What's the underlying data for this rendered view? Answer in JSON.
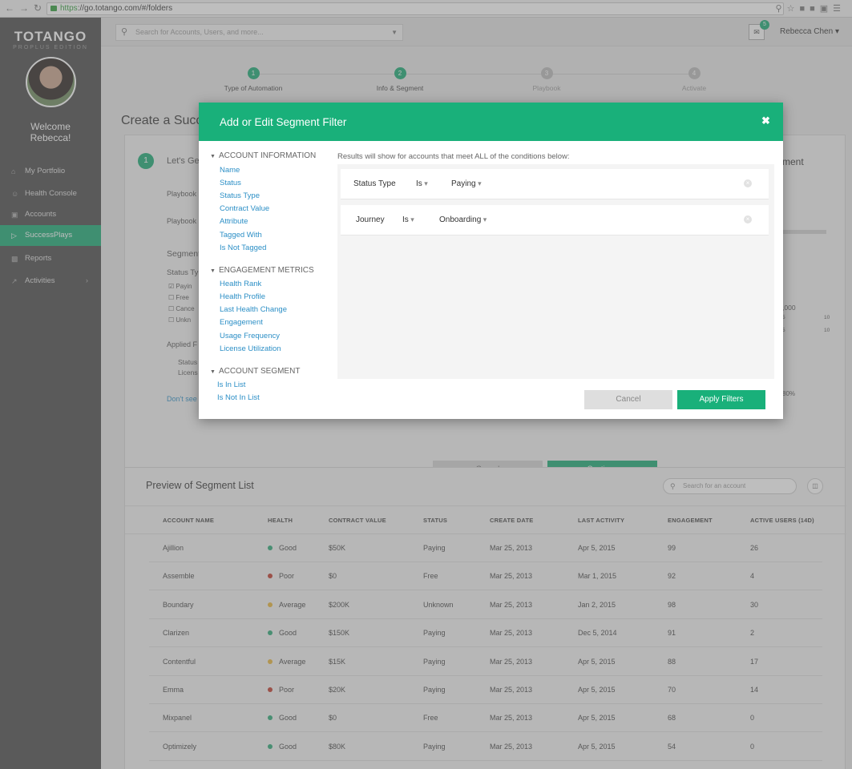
{
  "browser": {
    "url_https": "https",
    "url_rest": "://go.totango.com/#/folders"
  },
  "sidebar": {
    "logo": "TOTANGO",
    "edition": "PROPLUS EDITION",
    "welcome_line1": "Welcome",
    "welcome_line2": "Rebecca!",
    "items": [
      {
        "label": "My Portfolio",
        "icon": "home-icon"
      },
      {
        "label": "Health Console",
        "icon": "smiley-icon"
      },
      {
        "label": "Accounts",
        "icon": "briefcase-icon"
      },
      {
        "label": "SuccessPlays",
        "icon": "play-icon"
      },
      {
        "label": "Reports",
        "icon": "bar-chart-icon"
      },
      {
        "label": "Activities",
        "icon": "line-chart-icon"
      }
    ]
  },
  "header": {
    "search_placeholder": "Search for Accounts, Users, and more...",
    "inbox_count": "5",
    "user_name": "Rebecca Chen"
  },
  "steps": [
    {
      "num": "1",
      "label": "Type of Automation",
      "state": "done"
    },
    {
      "num": "2",
      "label": "Info & Segment",
      "state": "active"
    },
    {
      "num": "3",
      "label": "Playbook",
      "state": "todo"
    },
    {
      "num": "4",
      "label": "Activate",
      "state": "todo"
    }
  ],
  "page": {
    "title": "Create a Succ",
    "panel_step": "1",
    "lets_get": "Let's Ge",
    "playbook1": "Playbook",
    "playbook2": "Playbook",
    "segment": "Segment",
    "status_type": "Status Ty",
    "cb_paying": "Payin",
    "cb_free": "Free",
    "cb_cancel": "Cance",
    "cb_unknown": "Unkn",
    "applied": "Applied F",
    "applied_status": "Status",
    "applied_license": "Licens",
    "dont_see": "Don't see",
    "right_ment": "ment",
    "right_000": ",000",
    "right_5a": "5",
    "right_10a": "10",
    "right_5b": "5",
    "right_10b": "10",
    "right_80": "80%",
    "under_cancel": "Cancel",
    "under_continue": "Continue"
  },
  "modal": {
    "title": "Add or Edit Segment Filter",
    "note": "Results will show for accounts that meet ALL of the conditions below:",
    "groups": [
      {
        "title": "ACCOUNT INFORMATION",
        "items": [
          "Name",
          "Status",
          "Status Type",
          "Contract Value",
          "Attribute",
          "Tagged With",
          "Is Not Tagged"
        ]
      },
      {
        "title": "ENGAGEMENT METRICS",
        "items": [
          "Health Rank",
          "Health Profile",
          "Last Health Change",
          "Engagement",
          "Usage Frequency",
          "License Utilization"
        ]
      },
      {
        "title": "ACCOUNT SEGMENT",
        "items": [
          "Is In List",
          "Is Not In List"
        ]
      }
    ],
    "rules": [
      {
        "field": "Status Type",
        "op": "Is",
        "value": "Paying"
      },
      {
        "field": "Journey",
        "op": "Is",
        "value": "Onboarding"
      }
    ],
    "cancel": "Cancel",
    "apply": "Apply Filters"
  },
  "preview": {
    "title": "Preview of Segment List",
    "search_placeholder": "Search for an account",
    "columns": [
      "ACCOUNT NAME",
      "HEALTH",
      "CONTRACT VALUE",
      "STATUS",
      "CREATE DATE",
      "LAST ACTIVITY",
      "ENGAGEMENT",
      "ACTIVE USERS (14D)"
    ],
    "health_colors": {
      "Good": "#2aa876",
      "Poor": "#c0392b",
      "Average": "#e8b43a"
    },
    "rows": [
      [
        "Ajillion",
        "Good",
        "$50K",
        "Paying",
        "Mar 25, 2013",
        "Apr 5, 2015",
        "99",
        "26"
      ],
      [
        "Assemble",
        "Poor",
        "$0",
        "Free",
        "Mar 25, 2013",
        "Mar 1, 2015",
        "92",
        "4"
      ],
      [
        "Boundary",
        "Average",
        "$200K",
        "Unknown",
        "Mar 25, 2013",
        "Jan 2, 2015",
        "98",
        "30"
      ],
      [
        "Clarizen",
        "Good",
        "$150K",
        "Paying",
        "Mar 25, 2013",
        "Dec 5, 2014",
        "91",
        "2"
      ],
      [
        "Contentful",
        "Average",
        "$15K",
        "Paying",
        "Mar 25, 2013",
        "Apr 5, 2015",
        "88",
        "17"
      ],
      [
        "Emma",
        "Poor",
        "$20K",
        "Paying",
        "Mar 25, 2013",
        "Apr 5, 2015",
        "70",
        "14"
      ],
      [
        "Mixpanel",
        "Good",
        "$0",
        "Free",
        "Mar 25, 2013",
        "Apr 5, 2015",
        "68",
        "0"
      ],
      [
        "Optimizely",
        "Good",
        "$80K",
        "Paying",
        "Mar 25, 2013",
        "Apr 5, 2015",
        "54",
        "0"
      ]
    ]
  }
}
